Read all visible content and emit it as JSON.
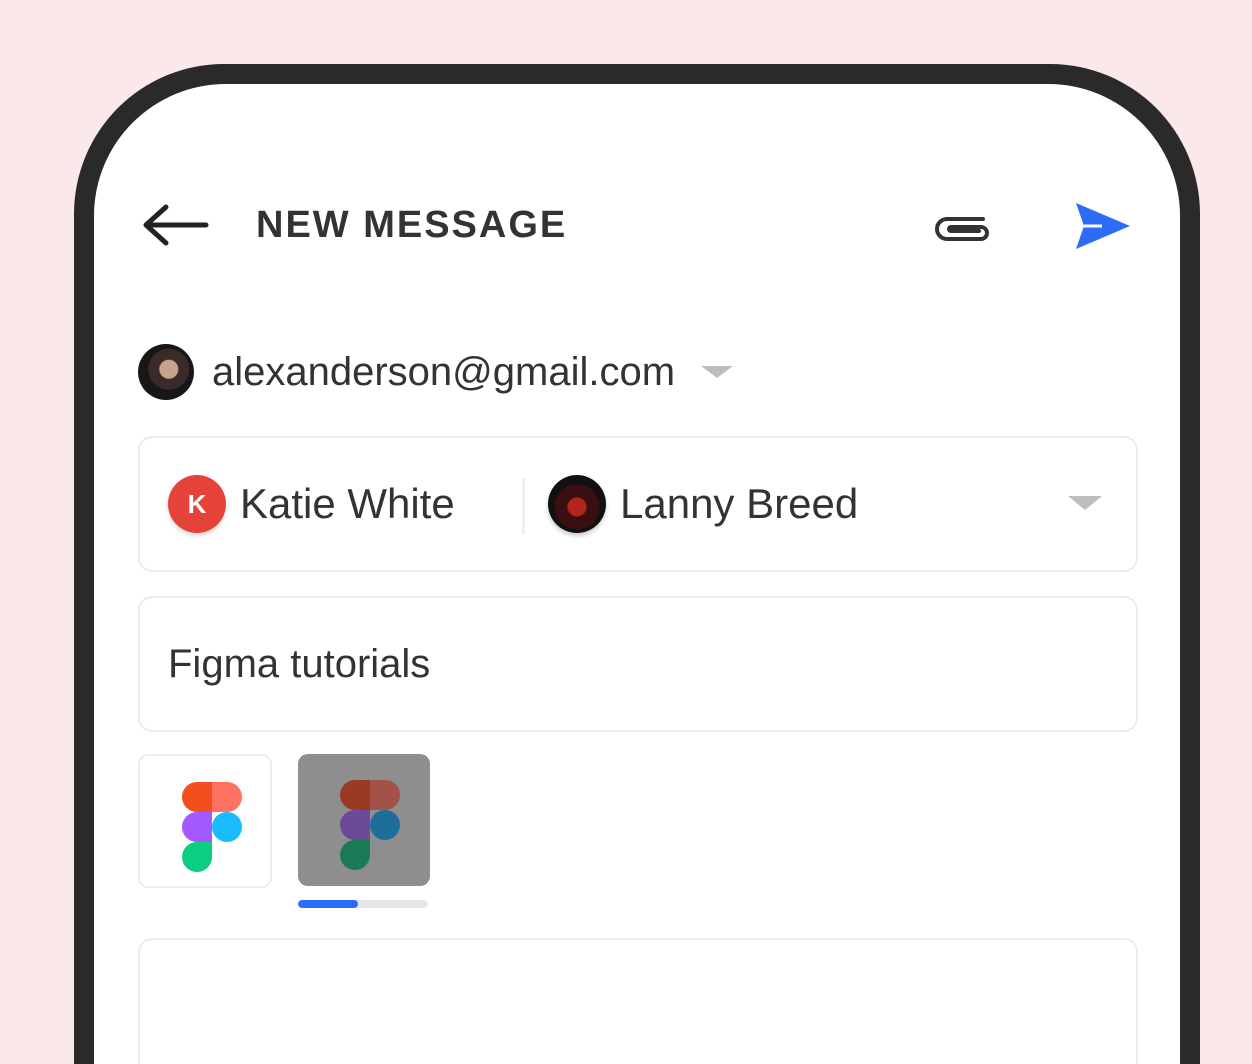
{
  "header": {
    "title": "NEW MESSAGE",
    "back_icon": "arrow-left-icon",
    "attach_icon": "paperclip-icon",
    "send_icon": "send-icon",
    "send_color": "#2d6cf6"
  },
  "from": {
    "email": "alexanderson@gmail.com"
  },
  "to": {
    "recipients": [
      {
        "name": "Katie White",
        "initial": "K",
        "color": "#e5433a"
      },
      {
        "name": "Lanny Breed"
      }
    ]
  },
  "subject": {
    "value": "Figma tutorials"
  },
  "attachments": {
    "items": [
      {
        "icon": "figma-logo-icon",
        "state": "uploaded"
      },
      {
        "icon": "figma-logo-icon",
        "state": "uploading"
      }
    ],
    "upload_progress": 0.46
  }
}
